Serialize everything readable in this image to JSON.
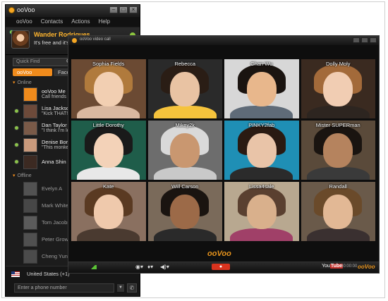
{
  "app": {
    "title": "ooVoo",
    "menus": [
      "ooVoo",
      "Contacts",
      "Actions",
      "Help"
    ]
  },
  "profile": {
    "name": "Wander Rodrigues",
    "status": "It's free and it's fun!"
  },
  "search": {
    "placeholder": "Quick Find"
  },
  "tabs": [
    "ooVoo",
    "Face"
  ],
  "sections": {
    "online": "Online",
    "offline": "Offline"
  },
  "online_contacts": [
    {
      "name": "ooVoo Me",
      "message": "Call friends h",
      "avatar_color": "#f08b1c"
    },
    {
      "name": "Lisa Jackson",
      "message": "\"Kick THAT!!\"",
      "avatar_color": "#6d4a3a"
    },
    {
      "name": "Dan Taylor",
      "message": "\"I think I'm lo",
      "avatar_color": "#7a5a48"
    },
    {
      "name": "Denise Bortl...",
      "message": "\"This monkey l",
      "avatar_color": "#c99a7c"
    },
    {
      "name": "Anna Shin",
      "message": "",
      "avatar_color": "#3c2a22"
    }
  ],
  "offline_contacts": [
    {
      "name": "Evelyn A"
    },
    {
      "name": "Mark White"
    },
    {
      "name": "Tom Jacobson"
    },
    {
      "name": "Peter Grow"
    },
    {
      "name": "Cheng Yun"
    }
  ],
  "dialer": {
    "country": "United States (+1)",
    "phone_placeholder": "Enter a phone number"
  },
  "video_window": {
    "title": "ooVoo video call",
    "participants": [
      {
        "name": "Sophia Fields",
        "bg": "#6b4a33",
        "skin": "#f2cfb2",
        "hair": "#b07a3c",
        "body": "#d9b8a0"
      },
      {
        "name": "Rebecca",
        "bg": "#2a2a2a",
        "skin": "#e9c3a3",
        "hair": "#2a1d15",
        "body": "#f5c33c"
      },
      {
        "name": "Chan Wu",
        "bg": "#d7d7d7",
        "skin": "#e8b78c",
        "hair": "#1a1410",
        "body": "#5f6b78"
      },
      {
        "name": "Dolly Moly",
        "bg": "#3a2a20",
        "skin": "#f1cdb3",
        "hair": "#a36a3a",
        "body": "#2d2520"
      },
      {
        "name": "Little Dorothy",
        "bg": "#1f5d4a",
        "skin": "#f3d2b8",
        "hair": "#1a1a1a",
        "body": "#e8e8e8"
      },
      {
        "name": "Mikey2k",
        "bg": "#6d6d6d",
        "skin": "#c99770",
        "hair": "#d9d9d9",
        "body": "#c9c9c9"
      },
      {
        "name": "PINKY2fab",
        "bg": "#1f8fb5",
        "skin": "#e9c4a8",
        "hair": "#2a1a12",
        "body": "#2b2b2b"
      },
      {
        "name": "Mister SUPERman",
        "bg": "#5a4a3a",
        "skin": "#b5835e",
        "hair": "#1a1410",
        "body": "#3a3a3a"
      },
      {
        "name": "Kate",
        "bg": "#8a7060",
        "skin": "#efc9ac",
        "hair": "#5a3a22",
        "body": "#4a3a30"
      },
      {
        "name": "Will Carson",
        "bg": "#7a6a5a",
        "skin": "#9c6a48",
        "hair": "#1a1410",
        "body": "#2a2a2a"
      },
      {
        "name": "Lissa4sale",
        "bg": "#b8a890",
        "skin": "#d9b08c",
        "hair": "#5a4030",
        "body": "#a04068"
      },
      {
        "name": "Randall",
        "bg": "#6a5a4a",
        "skin": "#e2b895",
        "hair": "#6a4a2a",
        "body": "#3a3030"
      }
    ],
    "logo_text": "ooVoo",
    "end_label": "●",
    "youtube": {
      "you": "You",
      "tube": "Tube"
    },
    "timer": "00:00:00",
    "brand_small": "ooVoo"
  },
  "colors": {
    "accent": "#f08b1c",
    "online_dot": "#8bc34a",
    "end_call": "#d9331e"
  }
}
